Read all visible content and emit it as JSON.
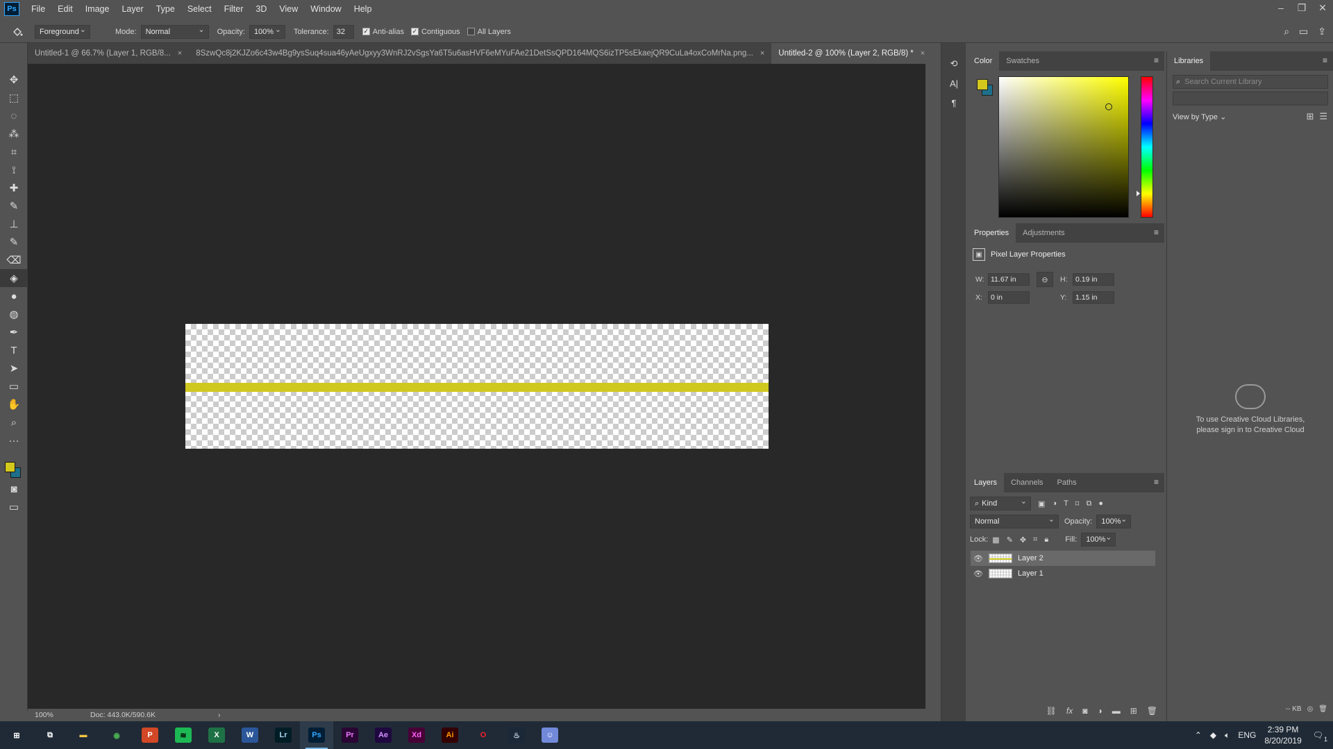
{
  "app": {
    "logo": "Ps"
  },
  "menubar": {
    "items": [
      "File",
      "Edit",
      "Image",
      "Layer",
      "Type",
      "Select",
      "Filter",
      "3D",
      "View",
      "Window",
      "Help"
    ]
  },
  "window_controls": {
    "minimize": "–",
    "restore": "❐",
    "close": "✕"
  },
  "options": {
    "fill_source": "Foreground",
    "mode_label": "Mode:",
    "mode_value": "Normal",
    "opacity_label": "Opacity:",
    "opacity_value": "100%",
    "tolerance_label": "Tolerance:",
    "tolerance_value": "32",
    "anti_alias": {
      "label": "Anti-alias",
      "checked": true
    },
    "contiguous": {
      "label": "Contiguous",
      "checked": true
    },
    "all_layers": {
      "label": "All Layers",
      "checked": false
    }
  },
  "tabs": [
    {
      "label": "Untitled-1 @ 66.7% (Layer 1, RGB/8...",
      "close": "×",
      "active": false
    },
    {
      "label": "8SzwQc8j2KJZo6c43w4Bg9ysSuq4sua46yAeUgxyy3WnRJ2vSgsYa6T5u6asHVF6eMYuFAe21DetSsQPD164MQS6izTP5sEkaejQR9CuLa4oxCoMrNa.png...",
      "close": "×",
      "active": false
    },
    {
      "label": "Untitled-2 @ 100% (Layer 2, RGB/8) *",
      "close": "×",
      "active": true
    }
  ],
  "canvas": {
    "stripe_color": "#cfc81f"
  },
  "status": {
    "zoom": "100%",
    "doc": "Doc: 443.0K/590.6K",
    "arrow": "›"
  },
  "color_panel": {
    "tabs": [
      "Color",
      "Swatches"
    ],
    "foreground": "#d4c81c",
    "background": "#1d6f8a",
    "hue_color": "#ffff00",
    "picker": {
      "saturation": 0.84,
      "value": 0.79
    },
    "hue_position": 0.83
  },
  "properties_panel": {
    "tabs": [
      "Properties",
      "Adjustments"
    ],
    "title": "Pixel Layer Properties",
    "w_label": "W:",
    "w_value": "11.67 in",
    "h_label": "H:",
    "h_value": "0.19 in",
    "x_label": "X:",
    "x_value": "0 in",
    "y_label": "Y:",
    "y_value": "1.15 in",
    "link_glyph": "⊖"
  },
  "layers_panel": {
    "tabs": [
      "Layers",
      "Channels",
      "Paths"
    ],
    "kind_label": "Kind",
    "blend_mode": "Normal",
    "opacity_label": "Opacity:",
    "opacity_value": "100%",
    "lock_label": "Lock:",
    "fill_label": "Fill:",
    "fill_value": "100%",
    "layers": [
      {
        "name": "Layer 2",
        "selected": true,
        "visible": true
      },
      {
        "name": "Layer 1",
        "selected": false,
        "visible": true
      }
    ],
    "footer_icons": [
      "link-icon",
      "fx-icon",
      "mask-icon",
      "adjustment-icon",
      "folder-icon",
      "new-layer-icon",
      "trash-icon"
    ]
  },
  "libraries_panel": {
    "title": "Libraries",
    "search_placeholder": "Search Current Library",
    "view_by": "View by Type",
    "message_line1": "To use Creative Cloud Libraries,",
    "message_line2": "please sign in to Creative Cloud",
    "kb": "-- KB"
  },
  "taskbar": {
    "apps": [
      {
        "name": "start",
        "glyph": "⊞",
        "color": "#ffffff",
        "bg": "transparent"
      },
      {
        "name": "task-view",
        "glyph": "⧉",
        "color": "#ffffff",
        "bg": "transparent"
      },
      {
        "name": "file-explorer",
        "glyph": "▬",
        "color": "#f5c542",
        "bg": "transparent"
      },
      {
        "name": "chrome",
        "glyph": "◉",
        "color": "#4caf50",
        "bg": "transparent"
      },
      {
        "name": "powerpoint",
        "glyph": "P",
        "color": "#ffffff",
        "bg": "#d24726"
      },
      {
        "name": "spotify",
        "glyph": "≋",
        "color": "#000000",
        "bg": "#1db954"
      },
      {
        "name": "excel",
        "glyph": "X",
        "color": "#ffffff",
        "bg": "#1e7145"
      },
      {
        "name": "word",
        "glyph": "W",
        "color": "#ffffff",
        "bg": "#2b579a"
      },
      {
        "name": "lightroom",
        "glyph": "Lr",
        "color": "#add5ec",
        "bg": "#001d26"
      },
      {
        "name": "photoshop",
        "glyph": "Ps",
        "color": "#31a8ff",
        "bg": "#001e36",
        "active": true
      },
      {
        "name": "premiere",
        "glyph": "Pr",
        "color": "#ea77ff",
        "bg": "#2a0634"
      },
      {
        "name": "after-effects",
        "glyph": "Ae",
        "color": "#d291ff",
        "bg": "#1f0740"
      },
      {
        "name": "xd",
        "glyph": "Xd",
        "color": "#ff61f6",
        "bg": "#470137"
      },
      {
        "name": "illustrator",
        "glyph": "Ai",
        "color": "#ff9a00",
        "bg": "#330000"
      },
      {
        "name": "opera",
        "glyph": "O",
        "color": "#ff1b2d",
        "bg": "transparent"
      },
      {
        "name": "steam",
        "glyph": "♨",
        "color": "#c6d4df",
        "bg": "#1b2838"
      },
      {
        "name": "discord",
        "glyph": "☺",
        "color": "#ffffff",
        "bg": "#7289da"
      }
    ],
    "language": "ENG",
    "time": "2:39 PM",
    "date": "8/20/2019",
    "notification_count": "1"
  },
  "tools": [
    "move-tool-icon",
    "marquee-tool-icon",
    "lasso-tool-icon",
    "magic-wand-icon",
    "crop-tool-icon",
    "eyedropper-icon",
    "healing-brush-icon",
    "brush-tool-icon",
    "clone-stamp-icon",
    "history-brush-icon",
    "eraser-icon",
    "paint-bucket-icon",
    "blur-tool-icon",
    "dodge-tool-icon",
    "pen-tool-icon",
    "type-tool-icon",
    "path-selection-icon",
    "rectangle-tool-icon",
    "hand-tool-icon",
    "zoom-tool-icon",
    "more-tools-icon"
  ]
}
